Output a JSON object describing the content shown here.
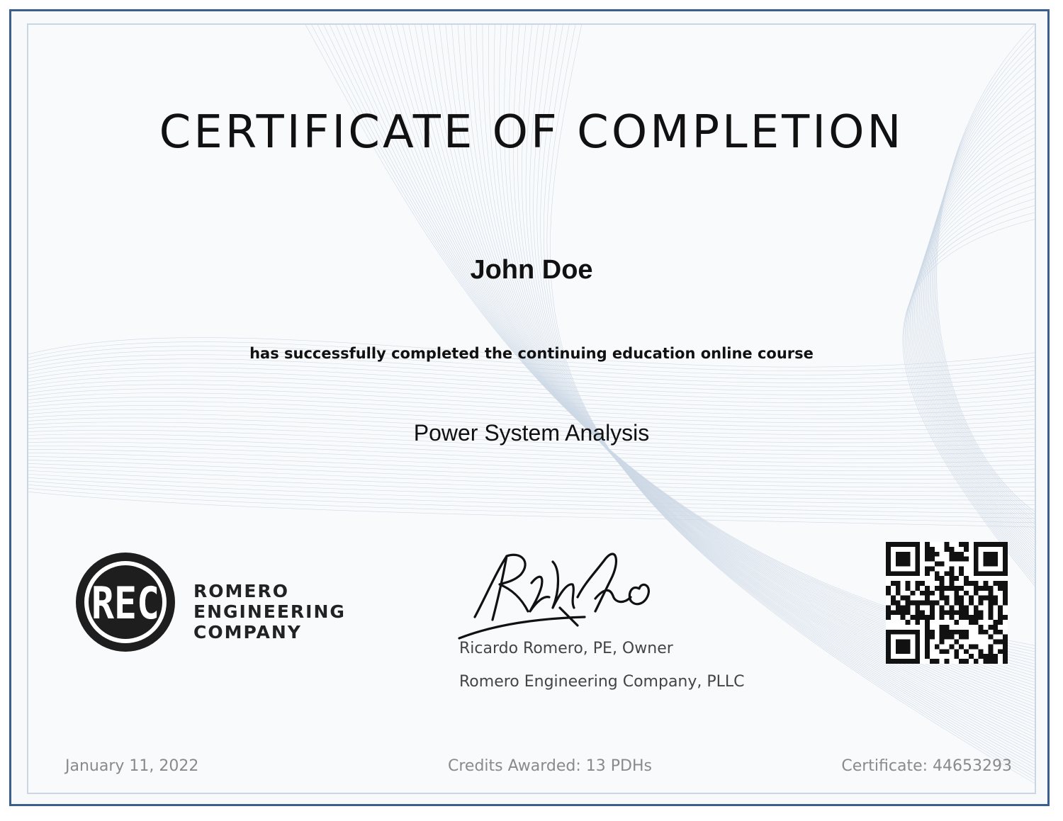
{
  "certificate": {
    "title": "CERTIFICATE OF COMPLETION",
    "recipient_name": "John Doe",
    "statement": "has successfully completed the continuing education online course",
    "course_name": "Power System Analysis"
  },
  "logo": {
    "monogram": "REC",
    "line1": "ROMERO",
    "line2": "ENGINEERING",
    "line3": "COMPANY"
  },
  "signatory": {
    "name_title": "Ricardo Romero, PE, Owner",
    "company": "Romero Engineering Company, PLLC"
  },
  "footer": {
    "date": "January 11, 2022",
    "credits": "Credits Awarded: 13 PDHs",
    "certificate_number": "Certificate: 44653293"
  },
  "colors": {
    "frame_border": "#3a5f8f",
    "inner_border": "#c9d6e4",
    "guilloche_lines": "#a9bdd3"
  },
  "icons": {
    "qr": "qr-code-icon",
    "logo": "rec-logo-icon",
    "signature": "signature-icon"
  }
}
